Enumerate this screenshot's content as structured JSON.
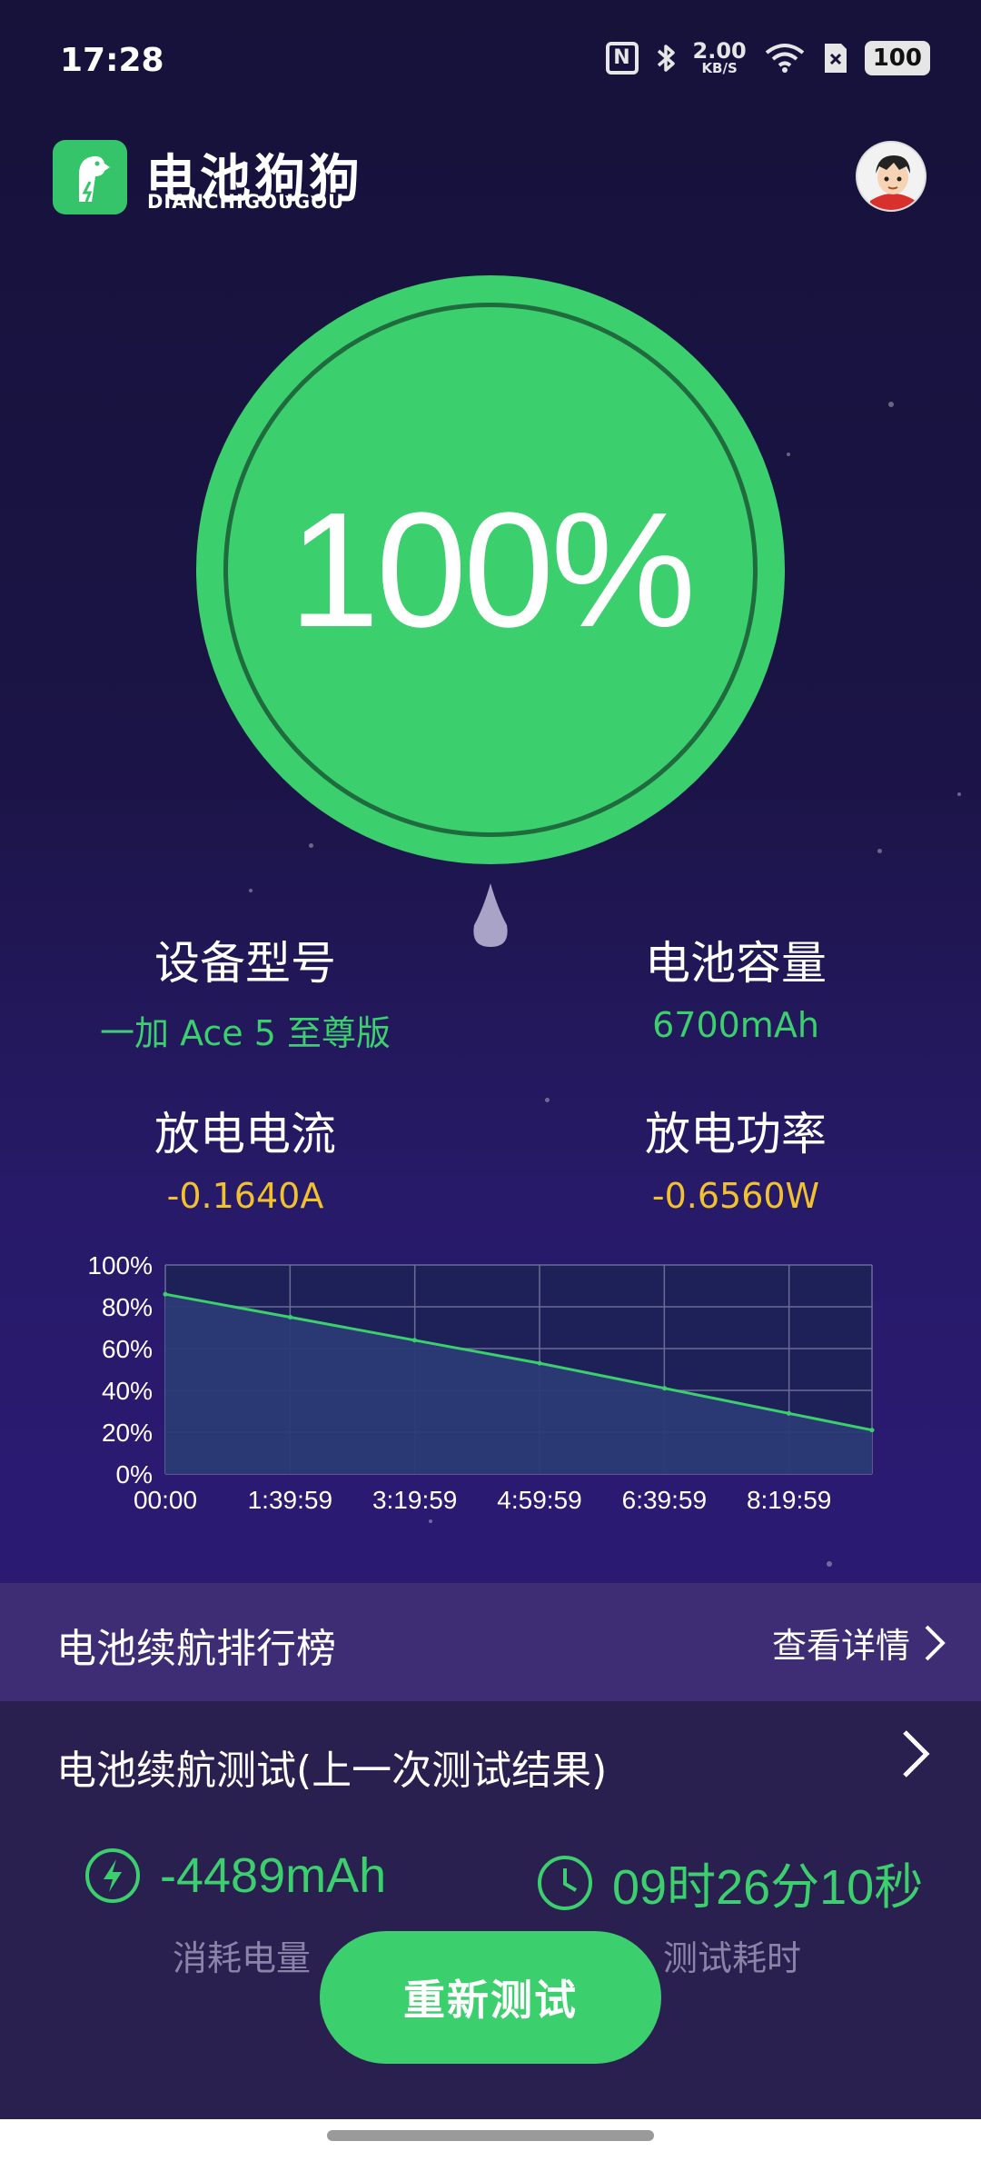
{
  "status_bar": {
    "time": "17:28",
    "speed_value": "2.00",
    "speed_unit": "KB/S",
    "battery_level": "100",
    "icons": [
      "nfc-icon",
      "bluetooth-icon",
      "wifi-icon",
      "sim-icon",
      "battery-icon"
    ]
  },
  "header": {
    "app_name": "电池狗狗",
    "app_name_latin": "DIANCHIGOUGOU"
  },
  "gauge": {
    "value": "100%",
    "level": 1.0,
    "color": "#3ccf6e"
  },
  "info": {
    "device_label": "设备型号",
    "device_value": "一加 Ace 5 至尊版",
    "capacity_label": "电池容量",
    "capacity_value": "6700mAh",
    "current_label": "放电电流",
    "current_value": "-0.1640A",
    "power_label": "放电功率",
    "power_value": "-0.6560W"
  },
  "chart_data": {
    "type": "line",
    "x_tick_labels": [
      "00:00",
      "1:39:59",
      "3:19:59",
      "4:59:59",
      "6:39:59",
      "8:19:59"
    ],
    "y_tick_labels": [
      "100%",
      "80%",
      "60%",
      "40%",
      "20%",
      "0%"
    ],
    "ylim": [
      0,
      100
    ],
    "xlim_hours": [
      0,
      9.44
    ],
    "grid": true,
    "series": [
      {
        "x_hours": [
          0,
          1.67,
          3.33,
          5.0,
          6.67,
          8.33,
          9.44
        ],
        "values": [
          86,
          75,
          64,
          53,
          41,
          29,
          21
        ],
        "color": "#3ccf6e",
        "fill": "#2b3a75"
      }
    ]
  },
  "ranking": {
    "title": "电池续航排行榜",
    "link_label": "查看详情"
  },
  "test": {
    "title": "电池续航测试(上一次测试结果)",
    "consumed_value": "-4489mAh",
    "consumed_label": "消耗电量",
    "duration_value": "09时26分10秒",
    "duration_label": "测试耗时",
    "retest_label": "重新测试"
  }
}
